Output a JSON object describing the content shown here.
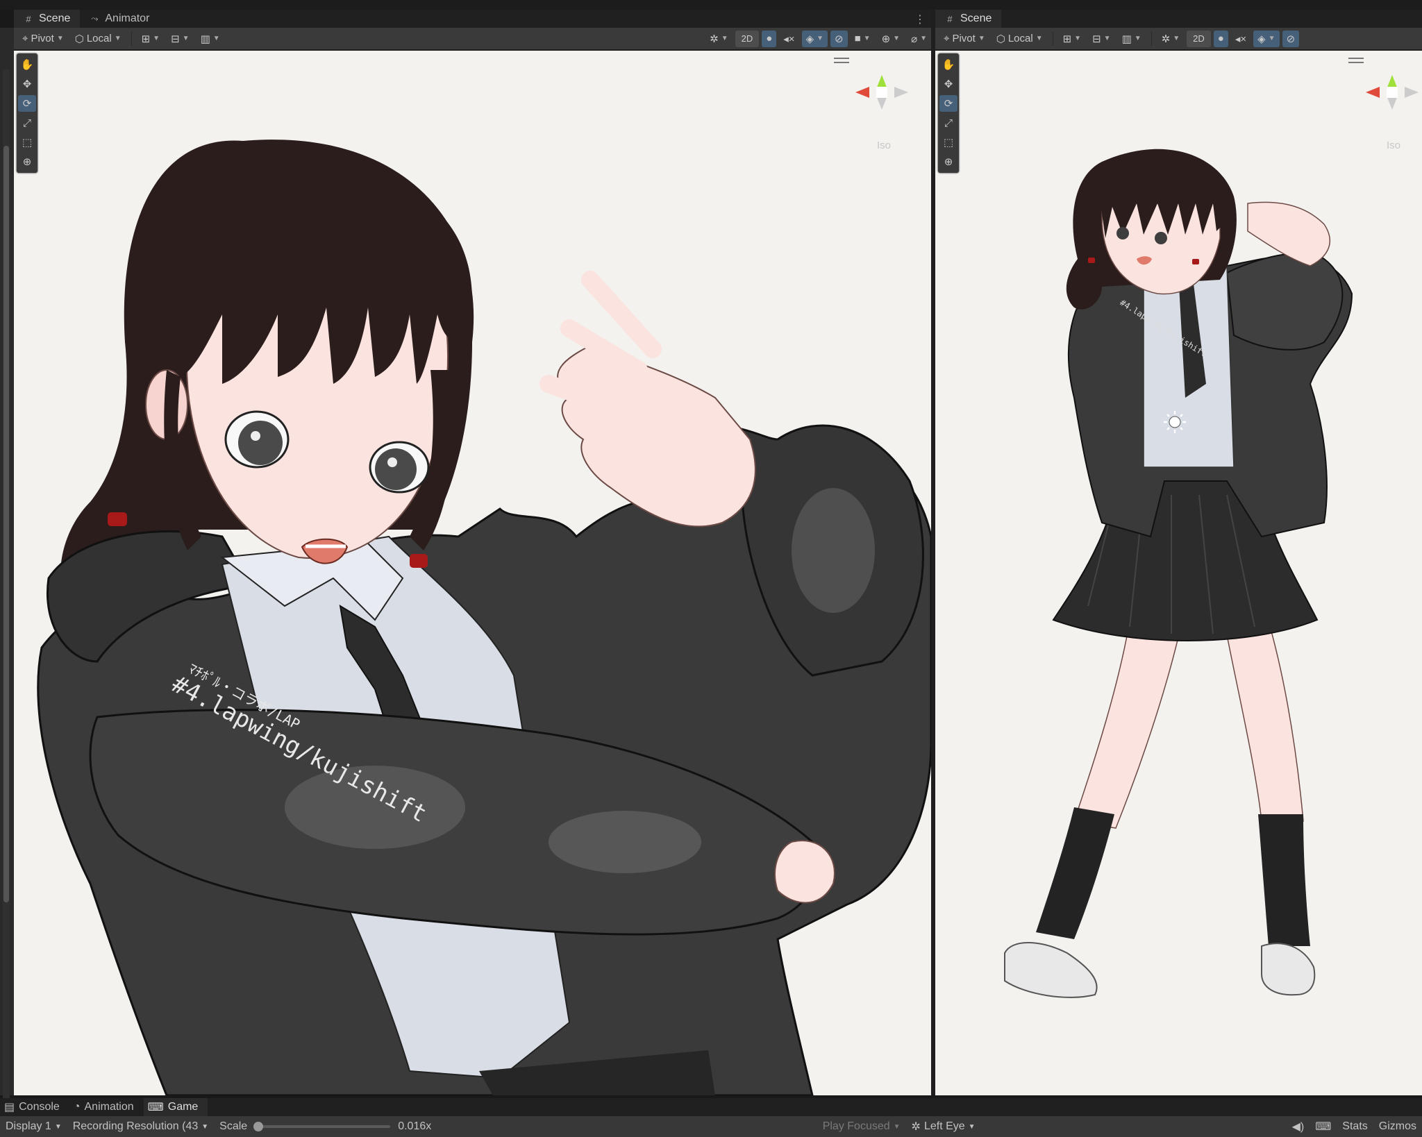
{
  "left_panel": {
    "tabs": [
      {
        "label": "Scene",
        "icon": "grid-icon"
      },
      {
        "label": "Animator",
        "icon": "animator-icon"
      }
    ],
    "toolbar": {
      "pivot_label": "Pivot",
      "local_label": "Local",
      "mode_2d_label": "2D"
    },
    "gizmo": {
      "projection_label": "Iso"
    }
  },
  "right_panel": {
    "tabs": [
      {
        "label": "Scene",
        "icon": "grid-icon"
      }
    ],
    "toolbar": {
      "pivot_label": "Pivot",
      "local_label": "Local",
      "mode_2d_label": "2D"
    },
    "gizmo": {
      "projection_label": "Iso"
    }
  },
  "scene_text": {
    "sleeve_print_small": "ﾏﾁﾎﾟﾙ・コラボ/LAP",
    "sleeve_print_main": "#4.lapwing/kujishift",
    "sleeve_print_right": "#4.lapwing/kujishift"
  },
  "bottom_tabs": [
    {
      "label": "Console",
      "icon": "console-icon"
    },
    {
      "label": "Animation",
      "icon": "animation-icon"
    },
    {
      "label": "Game",
      "icon": "gamepad-icon"
    }
  ],
  "game_bar": {
    "display_label": "Display 1",
    "resolution_label": "Recording Resolution (43",
    "scale_label": "Scale",
    "scale_value": "0.016x",
    "scale_level": 0.0,
    "play_focused_label": "Play Focused",
    "eye_label": "Left Eye",
    "stats_label": "Stats",
    "gizmos_label": "Gizmos"
  },
  "colors": {
    "viewport_bg": "#f4f2ef",
    "jacket": "#3a3a3a",
    "hair": "#2a1d1c",
    "skin": "#fbe3df",
    "shirt": "#d9dde6",
    "selection_blue": "#46607a"
  }
}
